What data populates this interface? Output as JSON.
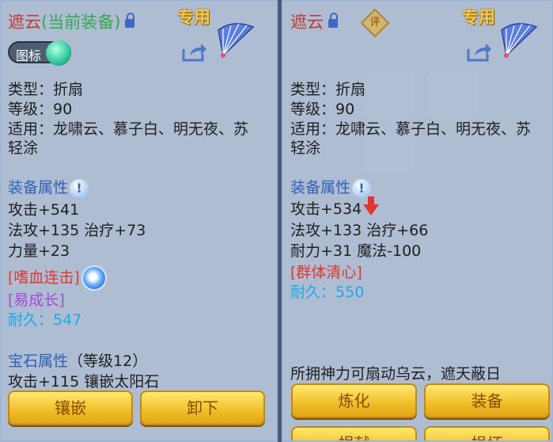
{
  "left": {
    "name": "遮云",
    "equipped_tag": "(当前装备)",
    "exclusive": "专用",
    "toggle_label": "图标",
    "type_line": "类型：折扇",
    "level_line": "等级：90",
    "suitable_line1": "适用：龙啸云、慕子白、明无夜、苏",
    "suitable_line2": "轻涂",
    "attr_heading": "装备属性",
    "attrs": [
      "攻击+541",
      "法攻+135 治疗+73",
      "力量+23"
    ],
    "special_skill": "[嗜血连击]",
    "special_effect": "[易成长]",
    "durability_label": "耐久：",
    "durability_value": "547",
    "gem_heading": "宝石属性",
    "gem_level": "（等级12）",
    "gem_line": "攻击+115 镶嵌太阳石",
    "buttons": [
      "镶嵌",
      "卸下"
    ]
  },
  "right": {
    "name": "遮云",
    "rating_badge": "评",
    "exclusive": "专用",
    "type_line": "类型：折扇",
    "level_line": "等级：90",
    "suitable_line1": "适用：龙啸云、慕子白、明无夜、苏",
    "suitable_line2": "轻涂",
    "attr_heading": "装备属性",
    "attack_line": "攻击+534",
    "attrs": [
      "法攻+133 治疗+66",
      "耐力+31 魔法-100"
    ],
    "special_skill": "[群体清心]",
    "durability_label": "耐久：",
    "durability_value": "550",
    "description": "所拥神力可扇动乌云，遮天蔽日",
    "buttons": [
      "炼化",
      "装备",
      "捐献",
      "损坏"
    ]
  }
}
